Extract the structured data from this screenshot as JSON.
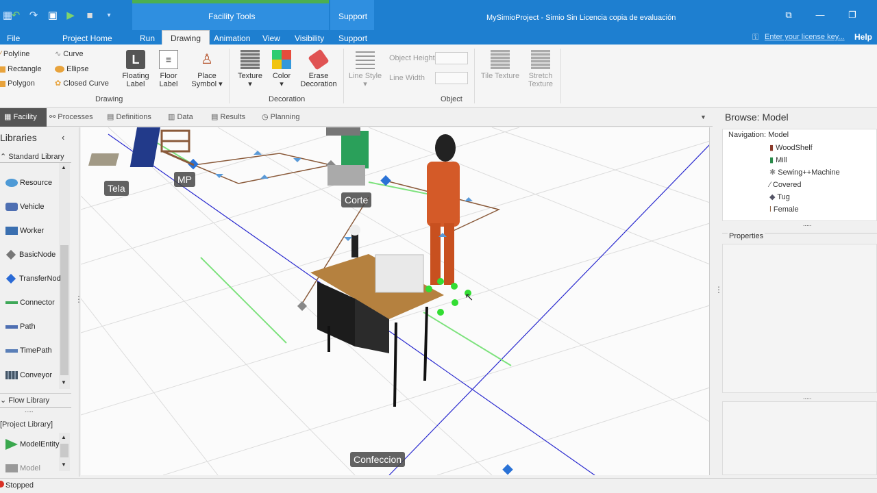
{
  "window": {
    "title": "MySimioProject - Simio Sin Licencia copia de evaluación",
    "license_link": "Enter your license key...",
    "help": "Help"
  },
  "context_groups": {
    "facility_tools": "Facility Tools",
    "support": "Support"
  },
  "tabs": {
    "file": "File",
    "project_home": "Project Home",
    "run": "Run",
    "drawing": "Drawing",
    "animation": "Animation",
    "view": "View",
    "visibility": "Visibility",
    "support": "Support"
  },
  "ribbon": {
    "drawing": {
      "polyline": "Polyline",
      "rectangle": "Rectangle",
      "polygon": "Polygon",
      "curve": "Curve",
      "ellipse": "Ellipse",
      "closed_curve": "Closed Curve",
      "floating_label": [
        "Floating",
        "Label"
      ],
      "floor_label": [
        "Floor",
        "Label"
      ],
      "place_symbol": [
        "Place",
        "Symbol"
      ],
      "group": "Drawing"
    },
    "decoration": {
      "texture": "Texture",
      "color": "Color",
      "erase": [
        "Erase",
        "Decoration"
      ],
      "group": "Decoration"
    },
    "object": {
      "line_style": "Line Style",
      "object_height": "Object Height",
      "line_width": "Line Width",
      "tile_texture": [
        "Tile Texture"
      ],
      "stretch_texture": [
        "Stretch",
        "Texture"
      ],
      "group": "Object"
    }
  },
  "view_tabs": [
    "Facility",
    "Processes",
    "Definitions",
    "Data",
    "Results",
    "Planning"
  ],
  "libraries": {
    "title": "Libraries",
    "standard": "Standard Library",
    "items": [
      "Resource",
      "Vehicle",
      "Worker",
      "BasicNode",
      "TransferNode",
      "Connector",
      "Path",
      "TimePath",
      "Conveyor"
    ],
    "flow": "Flow Library",
    "project": "[Project Library]",
    "project_items": [
      "ModelEntity",
      "Model"
    ]
  },
  "canvas_labels": {
    "tela": "Tela",
    "mp": "MP",
    "corte": "Corte",
    "confeccion": "Confeccion"
  },
  "browse": {
    "title": "Browse: Model",
    "nav_title": "Navigation: Model",
    "nav_items": [
      "WoodShelf",
      "Mill",
      "Sewing++Machine",
      "Covered",
      "Tug",
      "Female"
    ],
    "properties": "Properties",
    "dots": "....."
  },
  "status": {
    "text": "Stopped"
  },
  "colors": {
    "accent": "#1e7fd0",
    "facility_tools_bar": "#4caf50",
    "support_bar": "#2f8fe0"
  }
}
